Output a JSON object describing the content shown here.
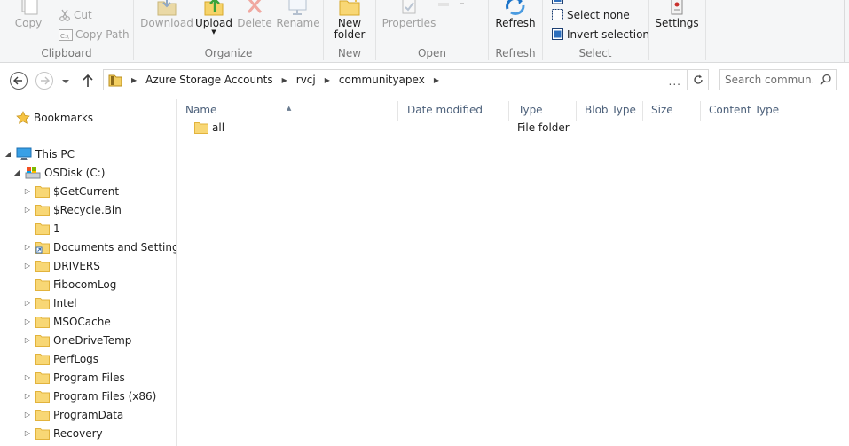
{
  "ribbon": {
    "clipboard": {
      "copy": "Copy",
      "cut": "Cut",
      "copy_path": "Copy Path",
      "label": "Clipboard"
    },
    "organize": {
      "download": "Download",
      "upload": "Upload",
      "delete": "Delete",
      "rename": "Rename",
      "label": "Organize"
    },
    "new": {
      "new_folder_line1": "New",
      "new_folder_line2": "folder",
      "label": "New"
    },
    "open": {
      "properties": "Properties",
      "label": "Open"
    },
    "refresh": {
      "refresh": "Refresh",
      "label": "Refresh"
    },
    "select": {
      "select_none": "Select none",
      "invert_selection": "Invert selection",
      "label": "Select"
    },
    "settings": {
      "settings": "Settings"
    }
  },
  "address": {
    "crumbs": [
      "Azure Storage Accounts",
      "rvcj",
      "communityapex"
    ],
    "dots": "...",
    "search_placeholder": "Search commun..."
  },
  "nav": {
    "bookmarks": "Bookmarks",
    "this_pc": "This PC",
    "osdisk": "OSDisk (C:)",
    "folders": [
      "$GetCurrent",
      "$Recycle.Bin",
      "1",
      "Documents and Settings",
      "DRIVERS",
      "FibocomLog",
      "Intel",
      "MSOCache",
      "OneDriveTemp",
      "PerfLogs",
      "Program Files",
      "Program Files (x86)",
      "ProgramData",
      "Recovery"
    ]
  },
  "columns": {
    "name": "Name",
    "date_modified": "Date modified",
    "type": "Type",
    "blob_type": "Blob Type",
    "size": "Size",
    "content_type": "Content Type"
  },
  "files": [
    {
      "name": "all",
      "type": "File folder"
    }
  ],
  "colors": {
    "folder": "#f8d775",
    "folder_dark": "#e2b33c",
    "accent_blue": "#1a73c9",
    "header_text": "#4c607a"
  }
}
